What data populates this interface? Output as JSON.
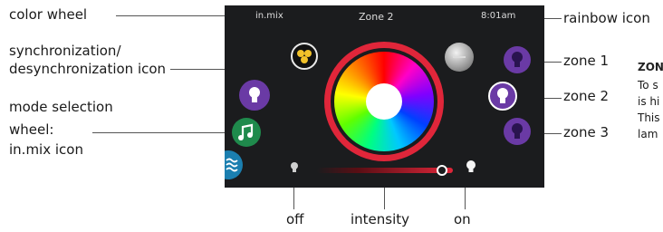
{
  "annotations": {
    "color_wheel": "color wheel",
    "sync_line1": "synchronization/",
    "sync_line2": "desynchronization icon",
    "mode_line1": "mode selection",
    "mode_line2": "wheel:",
    "mode_line3": "in.mix icon",
    "rainbow": "rainbow icon",
    "zone1": "zone 1",
    "zone2": "zone 2",
    "zone3": "zone 3",
    "off": "off",
    "intensity": "intensity",
    "on": "on"
  },
  "screen": {
    "brand": "in.mix",
    "title": "Zone 2",
    "time": "8:01am"
  },
  "sidebar": {
    "heading": "ZON",
    "line1": "To s",
    "line2": "is hi",
    "line3": "This",
    "line4": "lam"
  },
  "intensity": {
    "level": 0.92
  },
  "colors": {
    "ring": "#e0263a",
    "zone": "#6a3aa5",
    "music": "#1f8a4c",
    "water": "#1b7fb0",
    "sync": "#f2c22a"
  }
}
